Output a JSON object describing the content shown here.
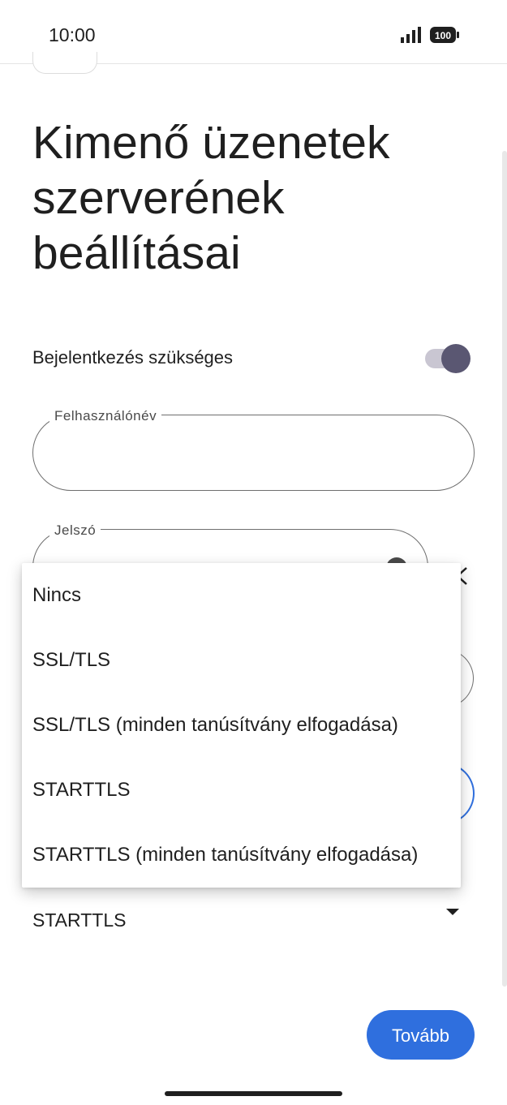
{
  "status_bar": {
    "time": "10:00",
    "battery": "100"
  },
  "page": {
    "title": "Kimenő üzenetek szerverének beállításai"
  },
  "auth": {
    "label": "Bejelentkezés szükséges",
    "enabled": true
  },
  "username": {
    "label": "Felhasználónév",
    "value": ""
  },
  "password": {
    "label": "Jelszó",
    "value": ""
  },
  "security": {
    "options": [
      "Nincs",
      "SSL/TLS",
      "SSL/TLS (minden tanúsítvány elfogadása)",
      "STARTTLS",
      "STARTTLS (minden tanúsítvány elfogadása)"
    ],
    "selected": "STARTTLS"
  },
  "next_button": {
    "label": "Tovább"
  },
  "colors": {
    "accent": "#2f6fde",
    "switch_knob": "#5a5772",
    "switch_track": "#c9c6d2"
  }
}
